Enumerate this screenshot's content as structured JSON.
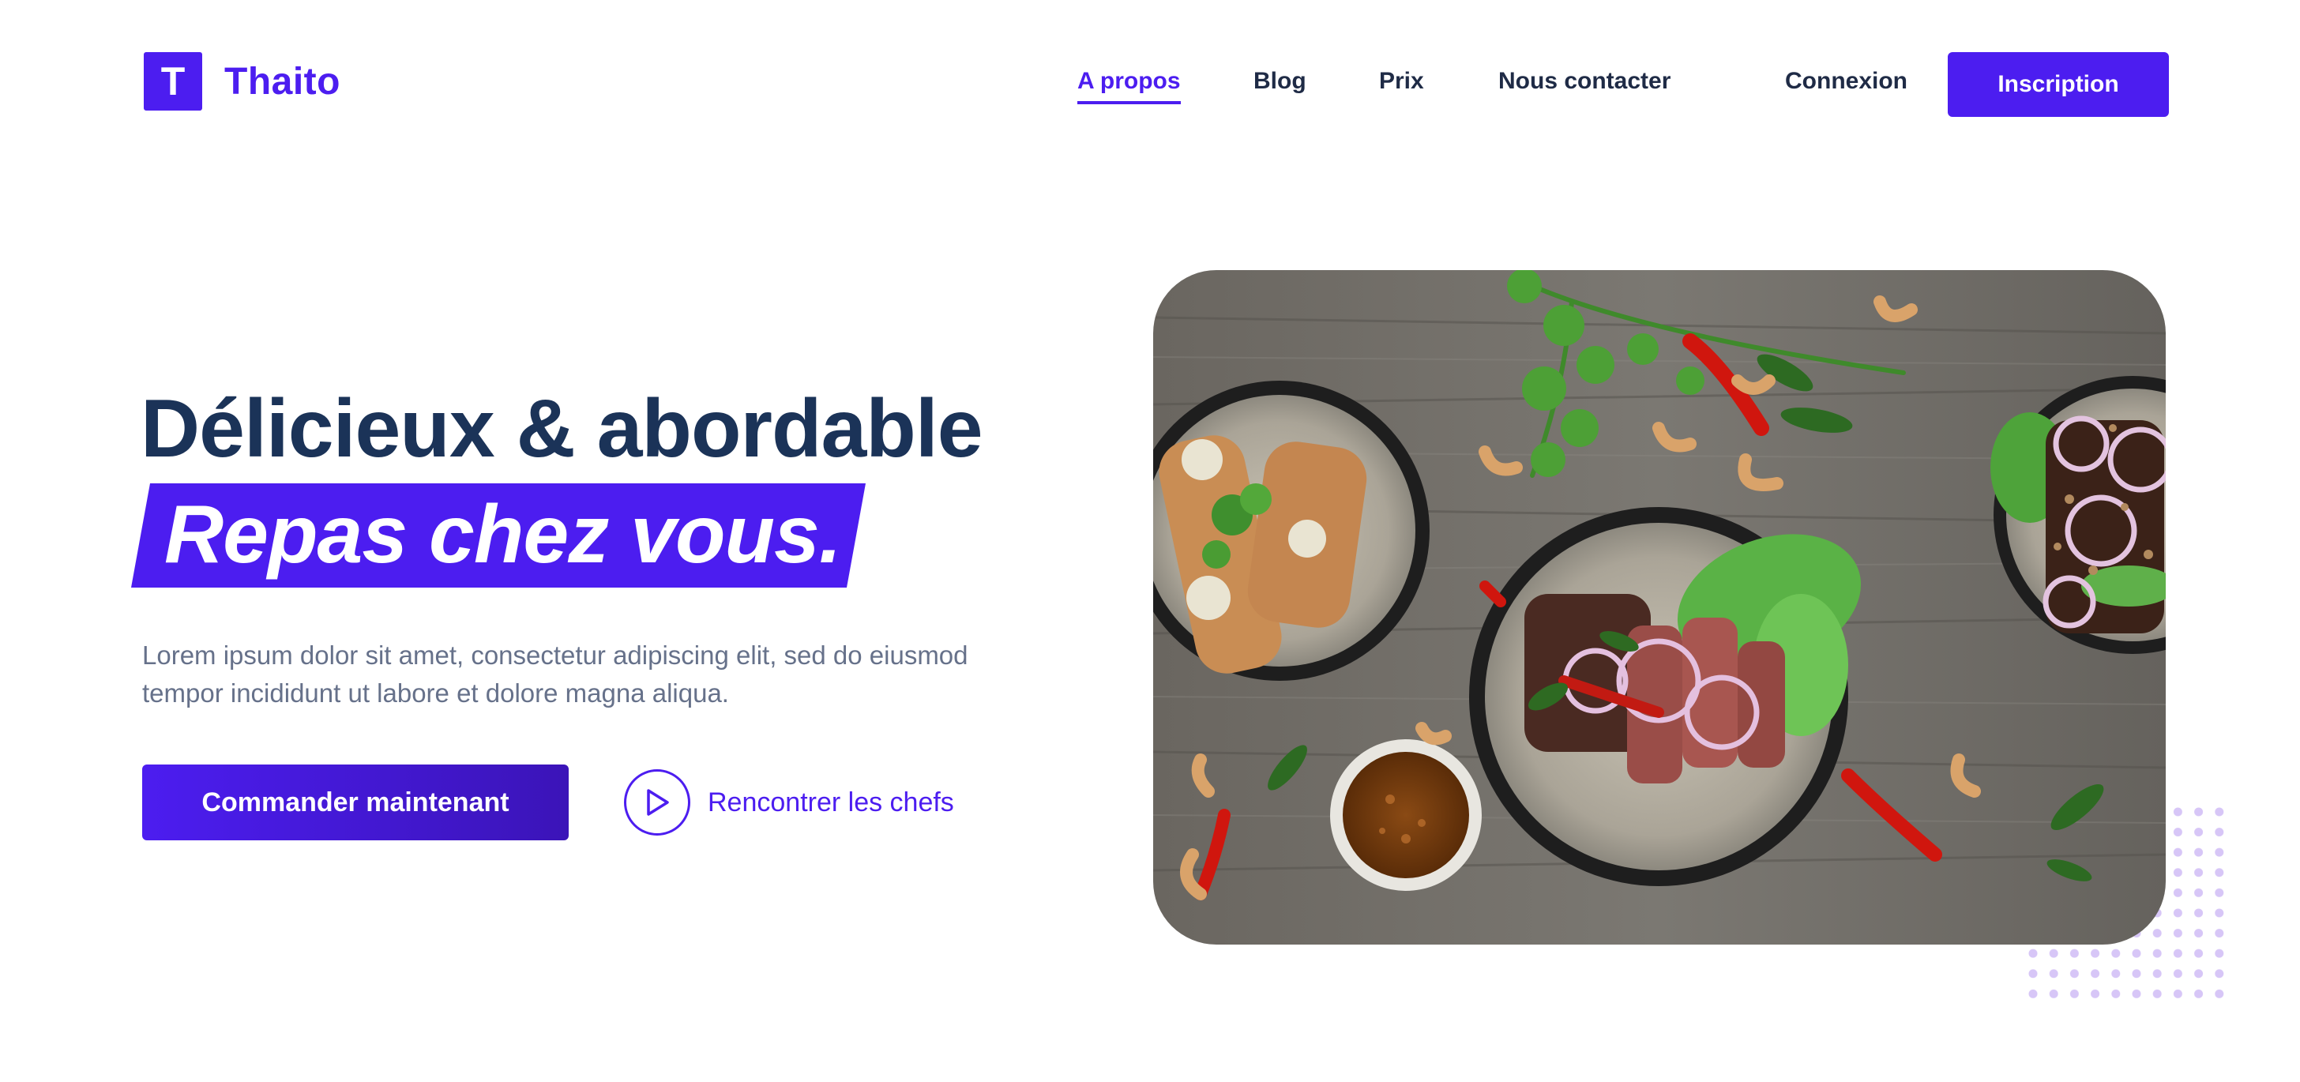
{
  "brand": {
    "logo_letter": "T",
    "name": "Thaito",
    "accent_color": "#4c1df0",
    "heading_color": "#1b3358"
  },
  "nav": {
    "items": [
      {
        "label": "A propos",
        "active": true
      },
      {
        "label": "Blog",
        "active": false
      },
      {
        "label": "Prix",
        "active": false
      },
      {
        "label": "Nous contacter",
        "active": false
      }
    ],
    "login_label": "Connexion",
    "signup_label": "Inscription"
  },
  "hero": {
    "title": "Délicieux & abordable",
    "highlight": "Repas chez vous.",
    "description": "Lorem ipsum dolor sit amet, consectetur adipiscing elit, sed do eiusmod tempor incididunt ut labore et dolore magna aliqua.",
    "primary_button": "Commander maintenant",
    "secondary_link": "Rencontrer les chefs",
    "secondary_icon": "play-icon"
  },
  "hero_image": {
    "subject": "food-bowls-on-wooden-table"
  }
}
